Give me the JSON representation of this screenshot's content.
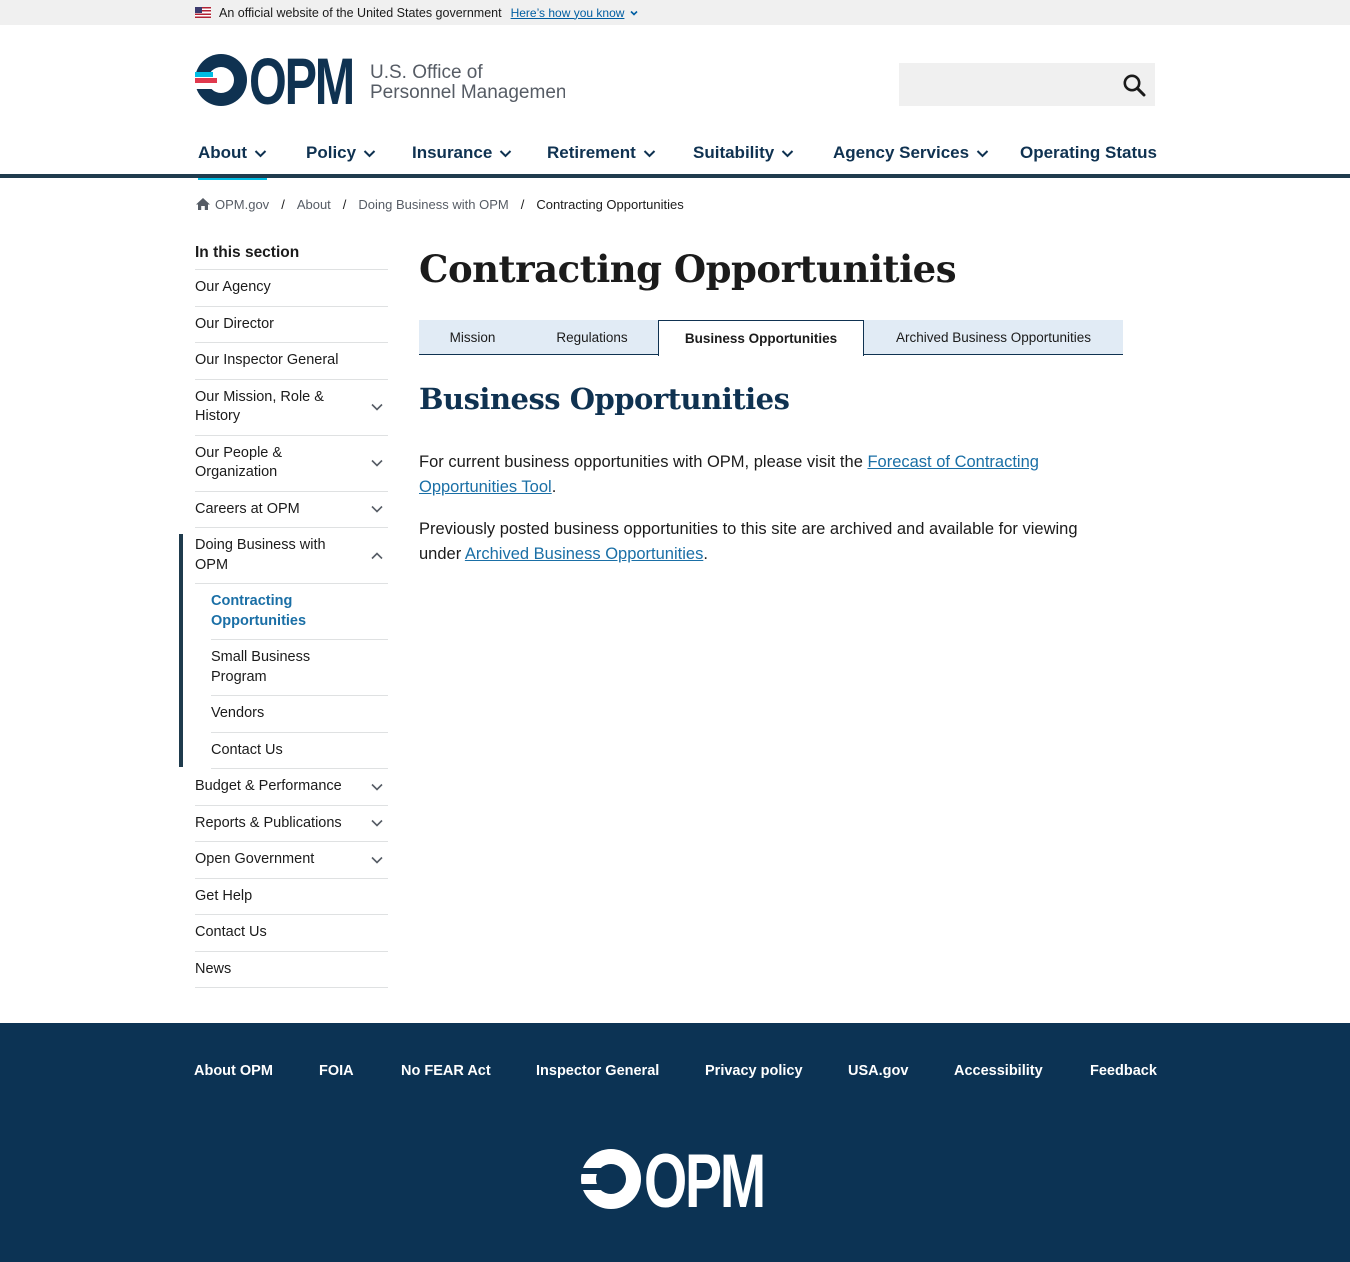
{
  "gov_banner": {
    "text": "An official website of the United States government",
    "link": "Here’s how you know"
  },
  "logo": {
    "letters": "OPM",
    "line1": "U.S. Office of",
    "line2": "Personnel Management"
  },
  "search": {
    "value": "",
    "placeholder": ""
  },
  "nav": {
    "items": [
      {
        "label": "About",
        "has_dropdown": true,
        "active": true
      },
      {
        "label": "Policy",
        "has_dropdown": true
      },
      {
        "label": "Insurance",
        "has_dropdown": true
      },
      {
        "label": "Retirement",
        "has_dropdown": true
      },
      {
        "label": "Suitability",
        "has_dropdown": true
      },
      {
        "label": "Agency Services",
        "has_dropdown": true
      },
      {
        "label": "Operating Status",
        "has_dropdown": false
      }
    ]
  },
  "breadcrumb": {
    "items": [
      "OPM.gov",
      "About",
      "Doing Business with OPM"
    ],
    "current": "Contracting Opportunities",
    "separator": "/"
  },
  "sidebar": {
    "title": "In this section",
    "items": [
      {
        "label": "Our Agency"
      },
      {
        "label": "Our Director"
      },
      {
        "label": "Our Inspector General"
      },
      {
        "label": "Our Mission, Role & History",
        "expandable": true
      },
      {
        "label": "Our People & Organization",
        "expandable": true
      },
      {
        "label": "Careers at OPM",
        "expandable": true
      },
      {
        "label": "Doing Business with OPM",
        "expandable": true,
        "expanded": true
      },
      {
        "label": "Budget & Performance",
        "expandable": true
      },
      {
        "label": "Reports & Publications",
        "expandable": true
      },
      {
        "label": "Open Government",
        "expandable": true
      },
      {
        "label": "Get Help"
      },
      {
        "label": "Contact Us"
      },
      {
        "label": "News"
      }
    ],
    "sub_items": [
      {
        "label": "Contracting Opportunities",
        "current": true
      },
      {
        "label": "Small Business Program"
      },
      {
        "label": "Vendors"
      },
      {
        "label": "Contact Us"
      }
    ]
  },
  "main": {
    "title": "Contracting Opportunities",
    "tabs": [
      {
        "label": "Mission"
      },
      {
        "label": "Regulations"
      },
      {
        "label": "Business Opportunities",
        "active": true
      },
      {
        "label": "Archived Business Opportunities"
      }
    ],
    "section_title": "Business Opportunities",
    "para1": {
      "before": "For current business opportunities with OPM, please visit the ",
      "link": "Forecast of Contracting Opportunities Tool",
      "after": "."
    },
    "para2": {
      "before": "Previously posted business opportunities to this site are archived and available for viewing under ",
      "link": "Archived Business Opportunities",
      "after": "."
    }
  },
  "footer": {
    "links": [
      "About OPM",
      "FOIA",
      "No FEAR Act",
      "Inspector General",
      "Privacy policy",
      "USA.gov",
      "Accessibility",
      "Feedback"
    ],
    "logo_letters": "OPM"
  },
  "colors": {
    "brand_navy": "#0f3251",
    "footer_bg": "#0c3354",
    "link": "#1a6fa6",
    "accent_cyan": "#00bde3",
    "flag_red": "#e0394d",
    "tab_bg": "#e1ebf5"
  }
}
